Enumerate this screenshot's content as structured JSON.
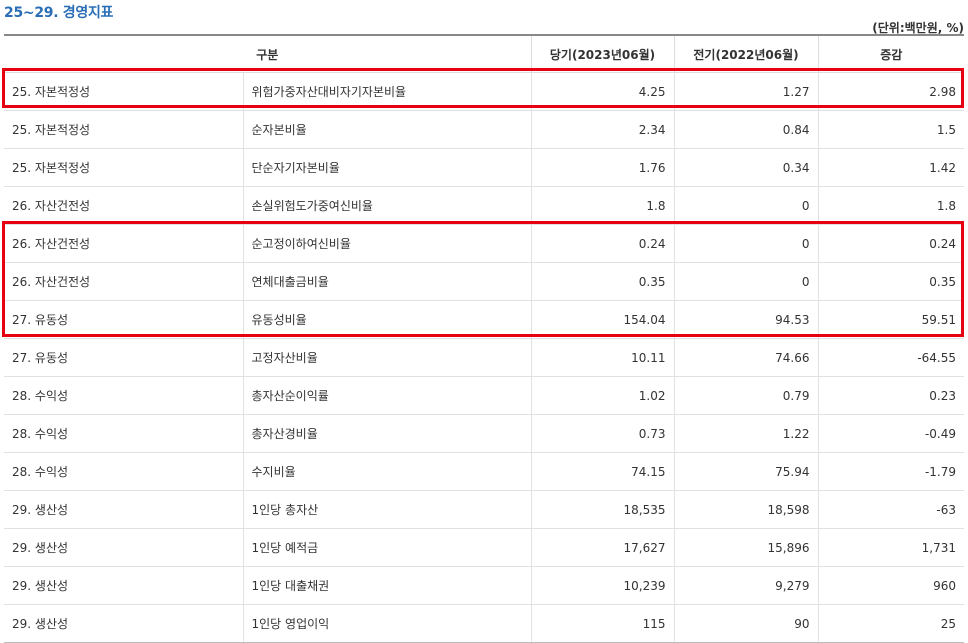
{
  "title": "25~29. 경영지표",
  "unit": "(단위:백만원, %)",
  "headers": [
    "구분",
    "당기(2023년06월)",
    "전기(2022년06월)",
    "증감"
  ],
  "rows": [
    {
      "category": "25. 자본적정성",
      "item": "위험가중자산대비자기자본비율",
      "current": "4.25",
      "previous": "1.27",
      "change": "2.98"
    },
    {
      "category": "25. 자본적정성",
      "item": "순자본비율",
      "current": "2.34",
      "previous": "0.84",
      "change": "1.5"
    },
    {
      "category": "25. 자본적정성",
      "item": "단순자기자본비율",
      "current": "1.76",
      "previous": "0.34",
      "change": "1.42"
    },
    {
      "category": "26. 자산건전성",
      "item": "손실위험도가중여신비율",
      "current": "1.8",
      "previous": "0",
      "change": "1.8"
    },
    {
      "category": "26. 자산건전성",
      "item": "순고정이하여신비율",
      "current": "0.24",
      "previous": "0",
      "change": "0.24"
    },
    {
      "category": "26. 자산건전성",
      "item": "연체대출금비율",
      "current": "0.35",
      "previous": "0",
      "change": "0.35"
    },
    {
      "category": "27. 유동성",
      "item": "유동성비율",
      "current": "154.04",
      "previous": "94.53",
      "change": "59.51"
    },
    {
      "category": "27. 유동성",
      "item": "고정자산비율",
      "current": "10.11",
      "previous": "74.66",
      "change": "-64.55"
    },
    {
      "category": "28. 수익성",
      "item": "총자산순이익률",
      "current": "1.02",
      "previous": "0.79",
      "change": "0.23"
    },
    {
      "category": "28. 수익성",
      "item": "총자산경비율",
      "current": "0.73",
      "previous": "1.22",
      "change": "-0.49"
    },
    {
      "category": "28. 수익성",
      "item": "수지비율",
      "current": "74.15",
      "previous": "75.94",
      "change": "-1.79"
    },
    {
      "category": "29. 생산성",
      "item": "1인당 총자산",
      "current": "18,535",
      "previous": "18,598",
      "change": "-63"
    },
    {
      "category": "29. 생산성",
      "item": "1인당 예적금",
      "current": "17,627",
      "previous": "15,896",
      "change": "1,731"
    },
    {
      "category": "29. 생산성",
      "item": "1인당 대출채권",
      "current": "10,239",
      "previous": "9,279",
      "change": "960"
    },
    {
      "category": "29. 생산성",
      "item": "1인당 영업이익",
      "current": "115",
      "previous": "90",
      "change": "25"
    }
  ],
  "highlight_color": "#e60012"
}
